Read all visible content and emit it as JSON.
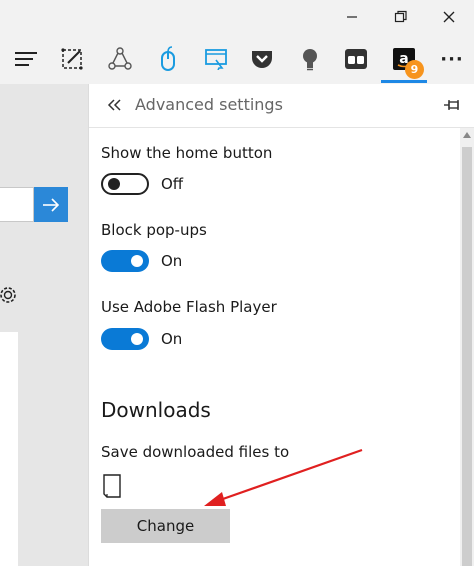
{
  "panel": {
    "title": "Advanced settings",
    "settings": [
      {
        "label": "Show the home button",
        "state": "Off"
      },
      {
        "label": "Block pop-ups",
        "state": "On"
      },
      {
        "label": "Use Adobe Flash Player",
        "state": "On"
      }
    ],
    "downloads": {
      "heading": "Downloads",
      "save_label": "Save downloaded files to",
      "change_label": "Change"
    }
  },
  "toolbar": {
    "amazon_badge_count": "9",
    "more_label": "···"
  },
  "colors": {
    "accent": "#0a7ad6",
    "badge": "#f7941d",
    "annotation_arrow": "#e02020"
  },
  "icons": [
    "hub-icon",
    "web-note-icon",
    "share-icon",
    "mouse-extension-icon",
    "screenshot-extension-icon",
    "pocket-icon",
    "lightbulb-icon",
    "tabs-extension-icon",
    "amazon-icon",
    "more-icon",
    "back-icon",
    "pin-icon",
    "folder-icon",
    "gear-icon",
    "arrow-right-icon"
  ]
}
